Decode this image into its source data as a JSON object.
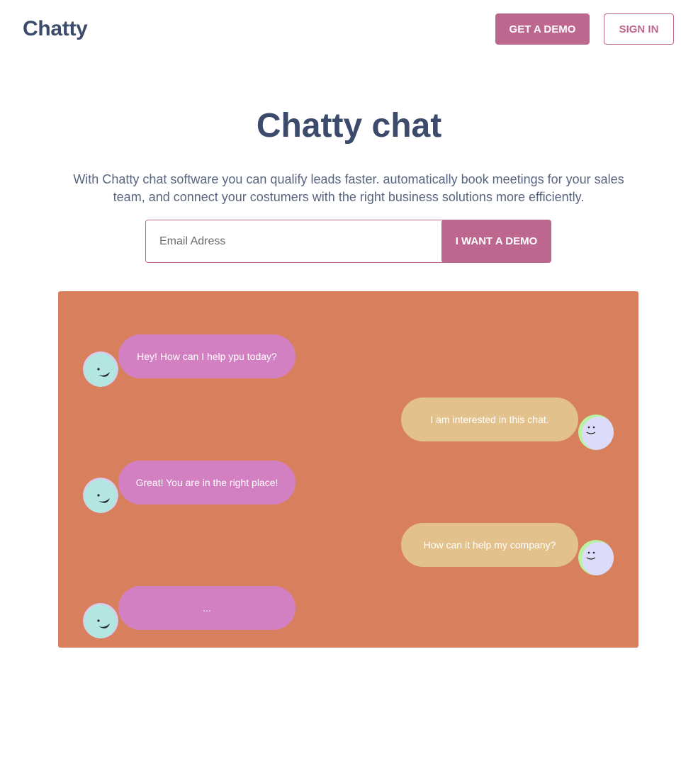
{
  "header": {
    "logo": "Chatty",
    "demo_button": "GET A DEMO",
    "signin_button": "SIGN IN"
  },
  "hero": {
    "title": "Chatty chat",
    "subtitle": "With Chatty chat software you can qualify leads faster. automatically book meetings for your sales team, and connect your costumers with the right business solutions more efficiently."
  },
  "form": {
    "email_placeholder": "Email Adress",
    "email_value": "",
    "submit_button": "I WANT A DEMO"
  },
  "chat": {
    "background": "#d8805d",
    "bot_bubble_color": "#d280c2",
    "user_bubble_color": "#e3c18c",
    "messages": [
      {
        "sender": "bot",
        "text": "Hey! How can I help ypu today?"
      },
      {
        "sender": "user",
        "text": "I am interested in this chat."
      },
      {
        "sender": "bot",
        "text": "Great! You are in the right place!"
      },
      {
        "sender": "user",
        "text": "How can it help my company?"
      },
      {
        "sender": "bot",
        "text": "..."
      }
    ]
  },
  "colors": {
    "brand": "#bd678e",
    "heading": "#3c4a6b"
  },
  "icons": {
    "bot_avatar": "smiling-face-icon",
    "user_avatar": "smiling-face-icon"
  }
}
